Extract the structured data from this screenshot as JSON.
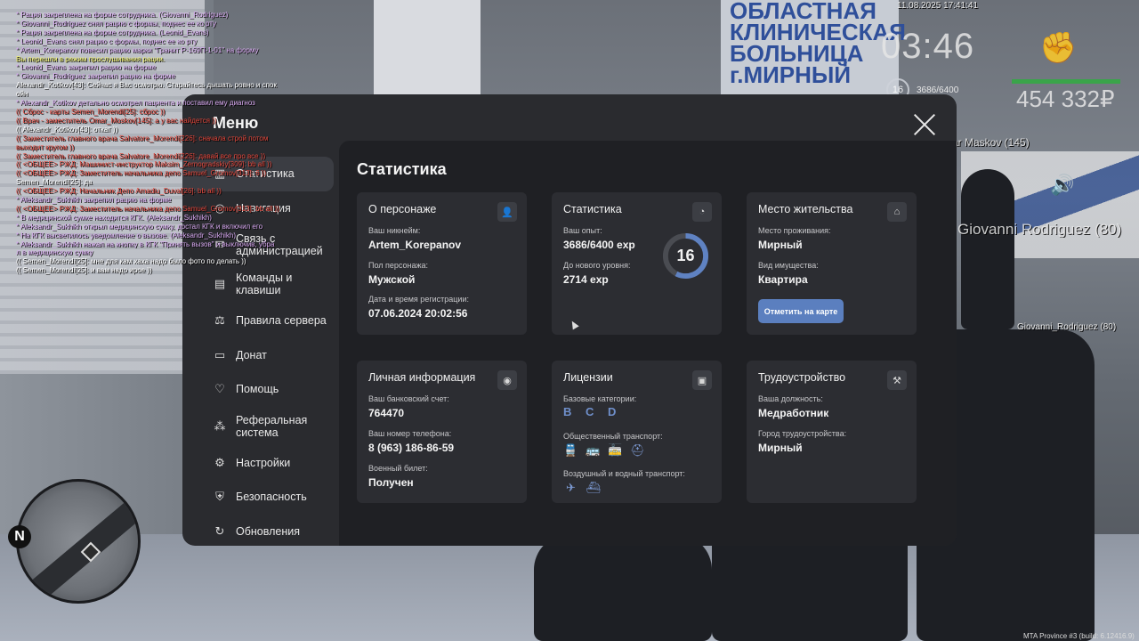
{
  "chat": [
    {
      "text": "* Рация закреплена на форме сотрудника. (Giovanni_Rodriguez)",
      "color": "#d7a8f0"
    },
    {
      "text": "* Giovanni_Rodriguez снял рацию с формы, поднес ее ко рту",
      "color": "#d7a8f0"
    },
    {
      "text": "* Рация закреплена на форме сотрудника. (Leonid_Evans)",
      "color": "#d7a8f0"
    },
    {
      "text": "* Leonid_Evans снял рацию с формы, поднес ее ко рту",
      "color": "#d7a8f0"
    },
    {
      "text": "* Artem_Korepanov повесил рацию марки \"Гранит Р-169П-1-01\" на форму",
      "color": "#d7a8f0"
    },
    {
      "text": "Вы перешли в режим прослушивания рации.",
      "color": "#f2f26a"
    },
    {
      "text": "* Leonid_Evans закрепил рацию на форме",
      "color": "#d7a8f0"
    },
    {
      "text": "* Giovanni_Rodriguez закрепил рацию на форме",
      "color": "#d7a8f0"
    },
    {
      "text": "Alexandr_Kotikov[43]: Сейчас я Вас осмотрю. Старайтесь дышать ровно и спок",
      "color": "#ffffff"
    },
    {
      "text": "ойн",
      "color": "#ffffff"
    },
    {
      "text": "* Alexandr_Kotikov детально осмотрел пациента и поставил ему диагноз",
      "color": "#d7a8f0"
    },
    {
      "text": "(( Сброс - карты Semen_Morendi[25]: сброс ))",
      "color": "#e0453a"
    },
    {
      "text": "(( Врач - заместитель Omar_Moskov[145]: а у вас найдется ))",
      "color": "#e0453a"
    },
    {
      "text": "(( Alexandr_Kotikov[43]: откат ))",
      "color": "#ffffff"
    },
    {
      "text": "(( Заместитель главного врача Salvatore_Morendi[226]: сначала строй потом",
      "color": "#e0453a"
    },
    {
      "text": "выходит кругом ))",
      "color": "#e0453a"
    },
    {
      "text": "(( Заместитель главного врача Salvatore_Morendi[226]: давай все про все ))",
      "color": "#e0453a"
    },
    {
      "text": "(( <ОБЩЕЕ> РЖД: Машинист-инструктор Maksim_Zernogradskiy[309]: bb all ))",
      "color": "#e0453a"
    },
    {
      "text": "(( <ОБЩЕЕ> РЖД: Заместитель начальника депо Samuel_Gromov[313]: 6 ))",
      "color": "#e0453a"
    },
    {
      "text": "Semen_Morendi[25]: да",
      "color": "#ffffff"
    },
    {
      "text": "(( <ОБЩЕЕ> РЖД: Начальник Депо Amadiu_Duval[26]: bb all ))",
      "color": "#e0453a"
    },
    {
      "text": "* Aleksandr_Sukhikh закрепил рацию на форме",
      "color": "#d7a8f0"
    },
    {
      "text": "(( <ОБЩЕЕ> РЖД: Заместитель начальника депо Samuel_Gromov[313]: bb all ))",
      "color": "#e0453a"
    },
    {
      "text": "* В медицинской сумке находится КГК. (Aleksandr_Sukhikh)",
      "color": "#d7a8f0"
    },
    {
      "text": "* Aleksandr_Sukhikh открыл медицинскую сумку, достал КГК и включил его",
      "color": "#d7a8f0"
    },
    {
      "text": "* На КГК высветилось уведомление о вызове. (Aleksandr_Sukhikh)",
      "color": "#d7a8f0"
    },
    {
      "text": "* Aleksandr_Sukhikh нажал на кнопку в КГК \"Принять вызов\" и выключив, убра",
      "color": "#d7a8f0"
    },
    {
      "text": "л в медицинскую сумку",
      "color": "#d7a8f0"
    },
    {
      "text": "(( Semen_Morendi[25]: мне для кам хаха надо было фото по делать ))",
      "color": "#ffffff"
    },
    {
      "text": "(( Semen_Morendi[25]: и вам надо ирое ))",
      "color": "#ffffff"
    }
  ],
  "hud": {
    "date": "11.08.2025 17:41:41",
    "time": "03:46",
    "level": "16",
    "exp": "3686/6400",
    "money": "454 332₽",
    "nick_main": "Giovanni Rodriguez (80)",
    "nick_small": "Giovanni_Rodriguez (80)",
    "nick_other": "ar Maskov (145)",
    "build": "MTA Province #3 (build: 6.12416.9)",
    "compass": "N"
  },
  "background": {
    "sign_lines": [
      "ОБЛАСТНАЯ",
      "КЛИНИЧЕСКАЯ",
      "БОЛЬНИЦА",
      "г.МИРНЫЙ"
    ]
  },
  "menu": {
    "title": "Меню",
    "sidebar": [
      {
        "label": "Статистика",
        "icon": "chart-icon",
        "glyph": "▥",
        "active": true
      },
      {
        "label": "Навигация",
        "icon": "compass-icon",
        "glyph": "◎"
      },
      {
        "label": "Связь с администрацией",
        "icon": "chat-icon",
        "glyph": "✉"
      },
      {
        "label": "Команды и клавиши",
        "icon": "document-icon",
        "glyph": "▤"
      },
      {
        "label": "Правила сервера",
        "icon": "scales-icon",
        "glyph": "⚖"
      },
      {
        "label": "Донат",
        "icon": "wallet-icon",
        "glyph": "▭"
      },
      {
        "label": "Помощь",
        "icon": "heart-hand-icon",
        "glyph": "♡"
      },
      {
        "label": "Реферальная система",
        "icon": "network-icon",
        "glyph": "⁂"
      },
      {
        "label": "Настройки",
        "icon": "gear-icon",
        "glyph": "⚙"
      },
      {
        "label": "Безопасность",
        "icon": "shield-icon",
        "glyph": "⛨"
      },
      {
        "label": "Обновления",
        "icon": "update-icon",
        "glyph": "↻"
      }
    ],
    "content_title": "Статистика",
    "cards": {
      "character": {
        "title": "О персонаже",
        "nickname_label": "Ваш никнейм:",
        "nickname": "Artem_Korepanov",
        "gender_label": "Пол персонажа:",
        "gender": "Мужской",
        "reg_label": "Дата и время регистрации:",
        "reg": "07.06.2024 20:02:56"
      },
      "stats": {
        "title": "Статистика",
        "exp_label": "Ваш опыт:",
        "exp": "3686/6400 exp",
        "next_label": "До нового уровня:",
        "next": "2714 exp",
        "level": "16",
        "progress": 0.576
      },
      "residence": {
        "title": "Место жительства",
        "place_label": "Место проживания:",
        "place": "Мирный",
        "property_label": "Вид имущества:",
        "property": "Квартира",
        "map_button": "Отметить на карте"
      },
      "personal": {
        "title": "Личная информация",
        "bank_label": "Ваш банковский счет:",
        "bank": "764470",
        "phone_label": "Ваш номер телефона:",
        "phone": "8 (963) 186-86-59",
        "military_label": "Военный билет:",
        "military": "Получен"
      },
      "licenses": {
        "title": "Лицензии",
        "base_label": "Базовые категории:",
        "base": "B C D",
        "public_label": "Общественный транспорт:",
        "air_label": "Воздушный и водный транспорт:"
      },
      "job": {
        "title": "Трудоустройство",
        "position_label": "Ваша должность:",
        "position": "Медработник",
        "city_label": "Город трудоустройства:",
        "city": "Мирный"
      }
    }
  }
}
